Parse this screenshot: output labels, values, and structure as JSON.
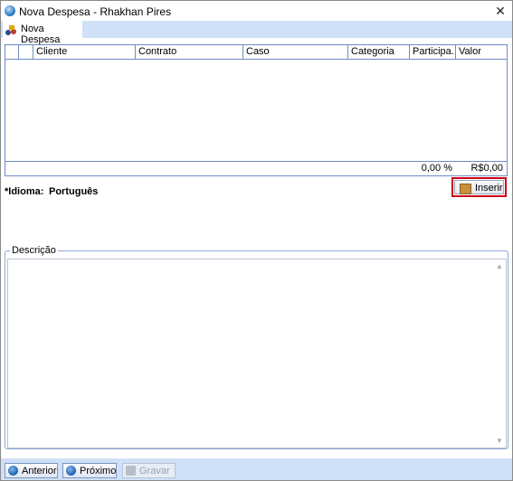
{
  "window": {
    "title": "Nova Despesa - Rhakhan Pires",
    "close_symbol": "✕"
  },
  "tabs": [
    {
      "label": "Nova Despesa"
    }
  ],
  "grid": {
    "columns": [
      "",
      "Cliente",
      "Contrato",
      "Caso",
      "Categoria",
      "Participa...",
      "Valor"
    ],
    "rows": [],
    "footer": {
      "percent": "0,00 %",
      "total": "R$0,00"
    }
  },
  "idioma": {
    "label": "Idioma:",
    "required_marker": "*",
    "value": "Português"
  },
  "actions": {
    "inserir_label": "Inserir"
  },
  "descricao": {
    "label": "Descrição",
    "value": ""
  },
  "footer_buttons": {
    "anterior": "Anterior",
    "proximo": "Próximo",
    "gravar": "Gravar"
  },
  "colors": {
    "accent": "#cfe0f7",
    "grid_border": "#6b8cc7",
    "highlight": "#d0021b"
  }
}
